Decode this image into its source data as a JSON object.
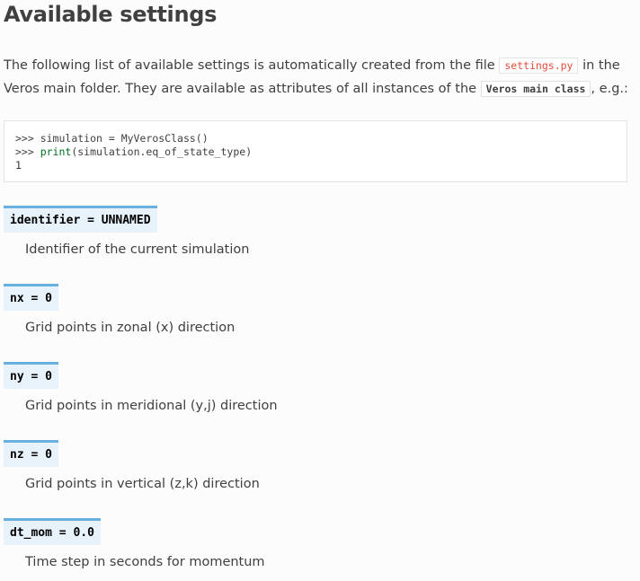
{
  "title": "Available settings",
  "intro": {
    "part1": "The following list of available settings is automatically created from the file ",
    "file": "settings.py",
    "part2": " in the Veros main folder. They are available as attributes of all instances of the ",
    "class_ref": "Veros main class",
    "part3": ", e.g.:"
  },
  "code": {
    "line1_prompt": ">>> ",
    "line1_code": "simulation = MyVerosClass()",
    "line2_prompt": ">>> ",
    "line2_keyword": "print",
    "line2_code": "(simulation.eq_of_state_type)",
    "line3_output": "1"
  },
  "settings": [
    {
      "signature": "identifier = UNNAMED",
      "description": "Identifier of the current simulation"
    },
    {
      "signature": "nx = 0",
      "description": "Grid points in zonal (x) direction"
    },
    {
      "signature": "ny = 0",
      "description": "Grid points in meridional (y,j) direction"
    },
    {
      "signature": "nz = 0",
      "description": "Grid points in vertical (z,k) direction"
    },
    {
      "signature": "dt_mom = 0.0",
      "description": "Time step in seconds for momentum"
    }
  ]
}
